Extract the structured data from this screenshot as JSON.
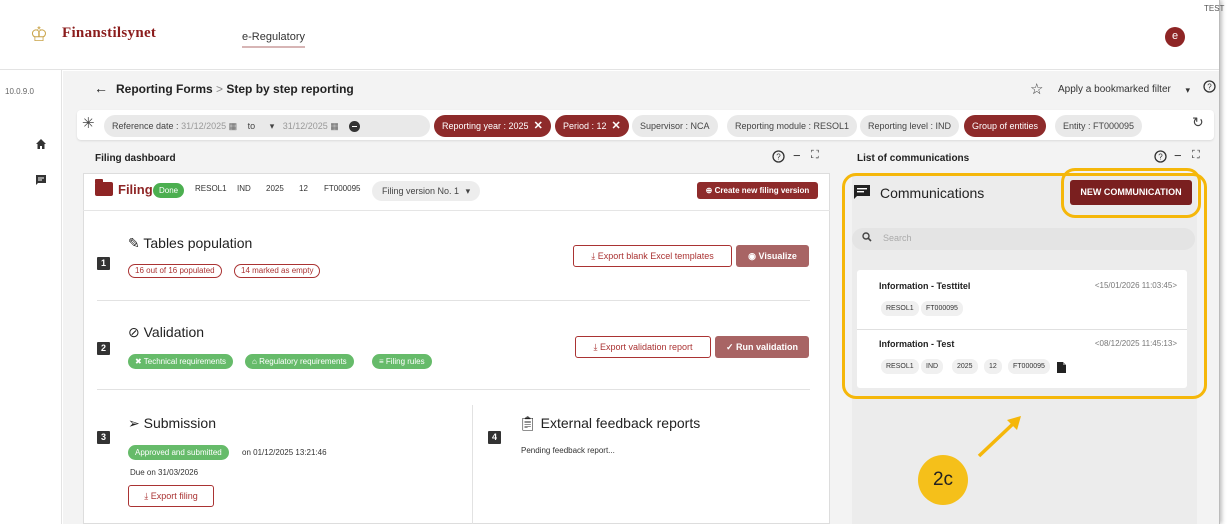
{
  "header": {
    "logo_text": "Finanstilsynet",
    "app_name": "e-Regulatory",
    "avatar_letter": "e",
    "env_label": "TEST"
  },
  "rail": {
    "version": "10.0.9.0",
    "icons": [
      "home-icon",
      "comment-icon"
    ]
  },
  "page": {
    "breadcrumb_parent": "Reporting Forms",
    "breadcrumb_sep": ">",
    "breadcrumb_current": "Step by step reporting",
    "bookmark_filter": "Apply a bookmarked filter"
  },
  "filters": {
    "reference_date_label": "Reference date :",
    "date_from": "31/12/2025",
    "to_label": "to",
    "date_to": "31/12/2025",
    "chips": [
      {
        "label": "Reporting year : 2025",
        "style": "red",
        "removable": true
      },
      {
        "label": "Period : 12",
        "style": "red",
        "removable": true
      },
      {
        "label": "Supervisor : NCA",
        "style": "grey",
        "removable": false
      },
      {
        "label": "Reporting module : RESOL1",
        "style": "grey",
        "removable": false
      },
      {
        "label": "Reporting level : IND",
        "style": "grey",
        "removable": false
      },
      {
        "label": "Group of entities",
        "style": "dark",
        "removable": false
      },
      {
        "label": "Entity : FT000095",
        "style": "grey",
        "removable": false
      }
    ]
  },
  "filing_dashboard": {
    "title": "Filing dashboard",
    "filing_label": "Filing",
    "status": "Done",
    "tags": [
      "RESOL1",
      "IND",
      "2025",
      "12",
      "FT000095"
    ],
    "version_select": "Filing version No. 1",
    "create_version_button": "Create new filing version",
    "steps": {
      "tables": {
        "number": "1",
        "title": "Tables population",
        "populated": "16 out of 16 populated",
        "empty": "14 marked as empty",
        "export_button": "Export blank Excel templates",
        "visualize_button": "Visualize"
      },
      "validation": {
        "number": "2",
        "title": "Validation",
        "technical": "Technical requirements",
        "regulatory": "Regulatory requirements",
        "filing_rules": "Filing rules",
        "export_button": "Export validation report",
        "run_button": "Run validation"
      },
      "submission": {
        "number": "3",
        "title": "Submission",
        "status": "Approved and submitted",
        "submitted_on": "on 01/12/2025 13:21:46",
        "due": "Due on 31/03/2026",
        "export_button": "Export filing"
      },
      "feedback": {
        "number": "4",
        "title": "External feedback reports",
        "pending": "Pending feedback report..."
      }
    }
  },
  "communications": {
    "panel_title": "List of communications",
    "title": "Communications",
    "new_button": "NEW COMMUNICATION",
    "search_placeholder": "Search",
    "messages": [
      {
        "title": "Information - Testtitel",
        "date": "<15/01/2026 11:03:45>",
        "tags": [
          "RESOL1",
          "FT000095"
        ]
      },
      {
        "title": "Information - Test",
        "date": "<08/12/2025 11:45:13>",
        "tags": [
          "RESOL1",
          "IND",
          "2025",
          "12",
          "FT000095"
        ]
      }
    ]
  },
  "annotation": {
    "label": "2c",
    "color": "#f5b70a"
  },
  "colors": {
    "brand": "#8e2525",
    "accent_gold": "#f5b70a",
    "success": "#66bb6a"
  }
}
